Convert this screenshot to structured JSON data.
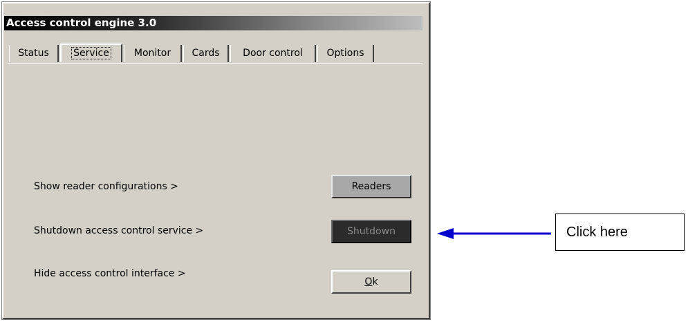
{
  "window": {
    "title": "Access control engine 3.0"
  },
  "tabs": [
    {
      "label": "Status"
    },
    {
      "label": "Service",
      "active": true
    },
    {
      "label": "Monitor"
    },
    {
      "label": "Cards"
    },
    {
      "label": "Door control"
    },
    {
      "label": "Options"
    }
  ],
  "rows": {
    "readers": {
      "label": "Show reader configurations  >",
      "button": "Readers"
    },
    "shutdown": {
      "label": "Shutdown access control service >",
      "button": "Shutdown"
    },
    "hide": {
      "label": "Hide access control interface >",
      "button_accel": "O",
      "button_rest": "k"
    }
  },
  "annotation": {
    "callout_text": "Click here",
    "arrow_color": "#0000cc"
  }
}
